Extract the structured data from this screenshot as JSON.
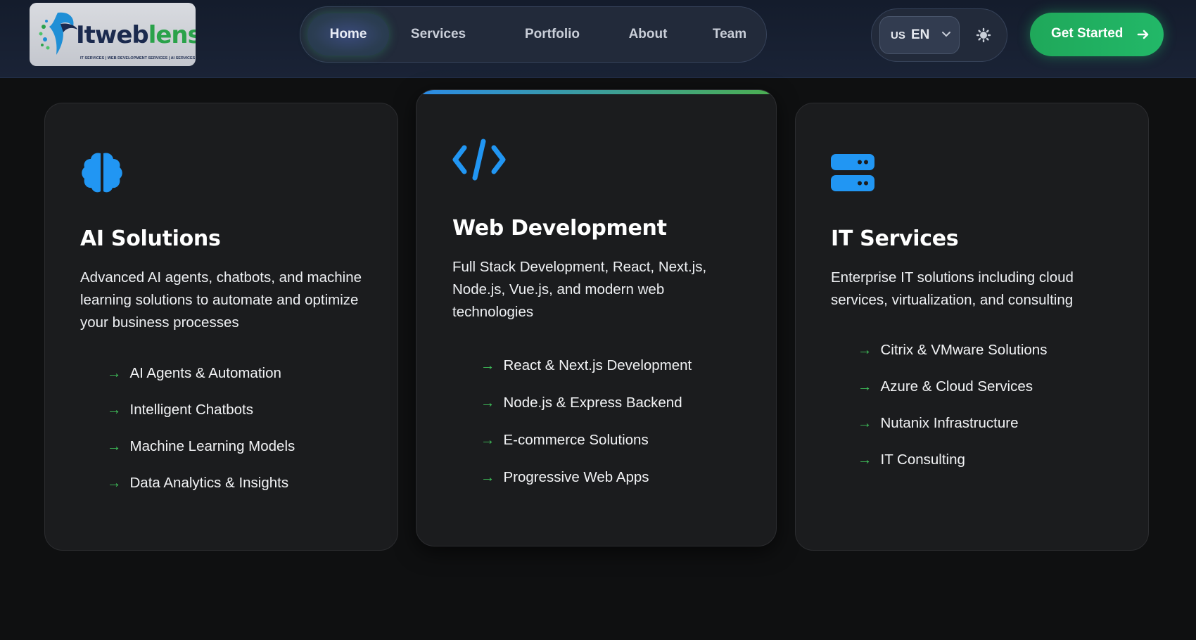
{
  "brand": {
    "name_part1": "Itweb",
    "name_part2": "lens",
    "tagline": "IT SERVICES | WEB DEVELOPMENT SERVICES | AI SERVICES"
  },
  "nav": {
    "items": [
      {
        "label": "Home",
        "active": true
      },
      {
        "label": "Services",
        "active": false
      },
      {
        "label": "Portfolio",
        "active": false
      },
      {
        "label": "About",
        "active": false
      },
      {
        "label": "Team",
        "active": false
      }
    ]
  },
  "language": {
    "flag": "US",
    "code": "EN",
    "icon": "chevron-down-icon"
  },
  "theme_toggle": {
    "icon": "sun-icon"
  },
  "cta": {
    "label": "Get Started",
    "icon": "arrow-right-icon"
  },
  "colors": {
    "accent_blue": "#2b8be8",
    "accent_green": "#22b868"
  },
  "cards": [
    {
      "icon": "brain-icon",
      "title": "AI Solutions",
      "description": "Advanced AI agents, chatbots, and machine learning solutions to automate and optimize your business processes",
      "features": [
        "AI Agents & Automation",
        "Intelligent Chatbots",
        "Machine Learning Models",
        "Data Analytics & Insights"
      ]
    },
    {
      "icon": "code-icon",
      "title": "Web Development",
      "description": "Full Stack Development, React, Next.js, Node.js, Vue.js, and modern web technologies",
      "features": [
        "React & Next.js Development",
        "Node.js & Express Backend",
        "E-commerce Solutions",
        "Progressive Web Apps"
      ]
    },
    {
      "icon": "server-icon",
      "title": "IT Services",
      "description": "Enterprise IT solutions including cloud services, virtualization, and consulting",
      "features": [
        "Citrix & VMware Solutions",
        "Azure & Cloud Services",
        "Nutanix Infrastructure",
        "IT Consulting"
      ]
    }
  ],
  "feature_arrow": "→"
}
